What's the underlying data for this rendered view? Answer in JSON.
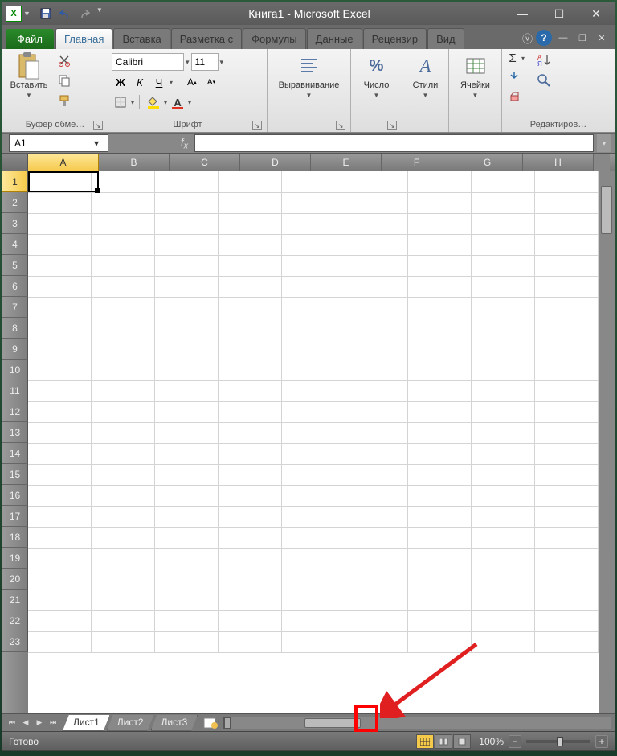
{
  "title": "Книга1  -  Microsoft Excel",
  "tabs": {
    "file": "Файл",
    "items": [
      "Главная",
      "Вставка",
      "Разметка с",
      "Формулы",
      "Данные",
      "Рецензир",
      "Вид"
    ],
    "activeIndex": 0
  },
  "ribbon": {
    "clipboard": {
      "paste": "Вставить",
      "label": "Буфер обме…"
    },
    "font": {
      "name": "Calibri",
      "size": "11",
      "bold": "Ж",
      "italic": "К",
      "underline": "Ч",
      "label": "Шрифт"
    },
    "alignment": {
      "label": "Выравнивание"
    },
    "number": {
      "label": "Число",
      "symbol": "%"
    },
    "styles": {
      "label": "Стили"
    },
    "cells": {
      "label": "Ячейки"
    },
    "editing": {
      "label": "Редактиров…",
      "sigma": "Σ"
    }
  },
  "nameBox": "A1",
  "formulaValue": "",
  "columns": [
    "A",
    "B",
    "C",
    "D",
    "E",
    "F",
    "G",
    "H"
  ],
  "rows": [
    "1",
    "2",
    "3",
    "4",
    "5",
    "6",
    "7",
    "8",
    "9",
    "10",
    "11",
    "12",
    "13",
    "14",
    "15",
    "16",
    "17",
    "18",
    "19",
    "20",
    "21",
    "22",
    "23"
  ],
  "sheets": {
    "items": [
      "Лист1",
      "Лист2",
      "Лист3"
    ],
    "activeIndex": 0
  },
  "status": {
    "ready": "Готово",
    "zoom": "100%"
  }
}
